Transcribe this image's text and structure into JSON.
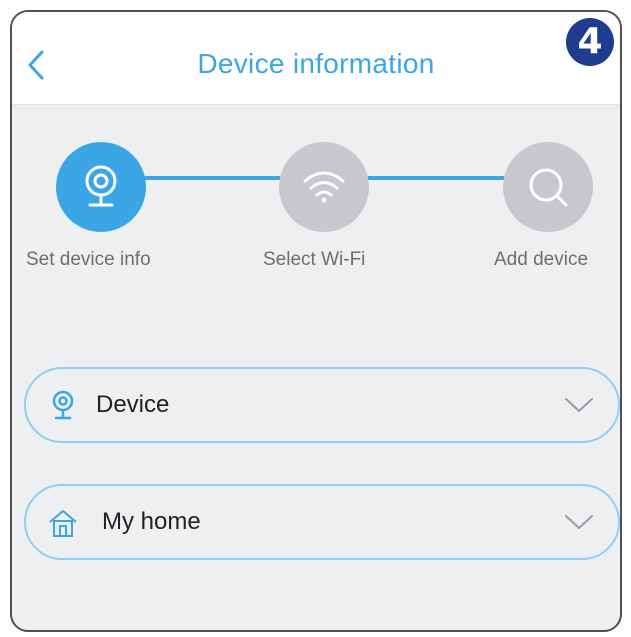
{
  "header": {
    "title": "Device information",
    "step_number": "4"
  },
  "steps": [
    {
      "label": "Set device info",
      "icon": "camera-icon",
      "state": "active"
    },
    {
      "label": "Select Wi-Fi",
      "icon": "wifi-icon",
      "state": "inactive"
    },
    {
      "label": "Add device",
      "icon": "search-icon",
      "state": "inactive"
    }
  ],
  "form": {
    "device": {
      "value": "Device",
      "icon": "camera-icon"
    },
    "home": {
      "value": "My home",
      "icon": "home-icon"
    }
  },
  "colors": {
    "accent": "#3aa6e6",
    "inactive": "#c7c8cb",
    "background": "#eeeff1",
    "field_border": "#8fd0f2",
    "badge": "#1f3d8f"
  }
}
